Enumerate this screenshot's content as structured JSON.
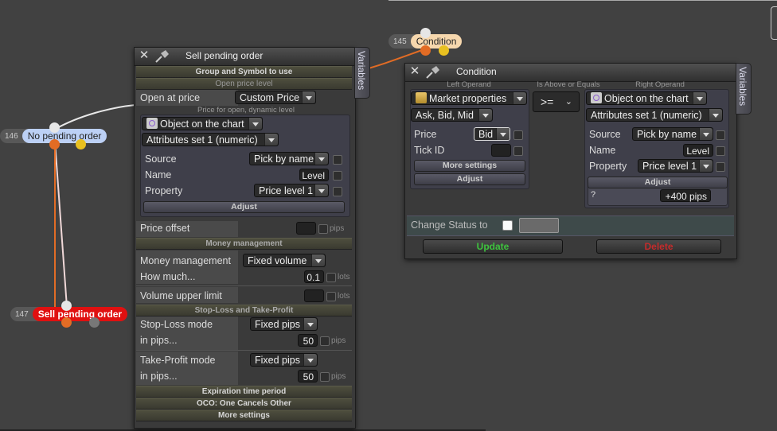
{
  "colors": {
    "accent_orange": "#e26c25",
    "node_blue": "#bcd0f5",
    "node_red": "#e01010",
    "update_green": "#3ec33e",
    "delete_red": "#c42b2b"
  },
  "nodes": [
    {
      "num": "145",
      "label": "Condition"
    },
    {
      "num": "146",
      "label": "No pending order"
    },
    {
      "num": "147",
      "label": "Sell pending order"
    }
  ],
  "sell_panel": {
    "title": "Sell pending order",
    "variables_tab": "Variables",
    "sections": {
      "group_symbol": "Group and Symbol to use",
      "open_price": "Open price level",
      "money": "Money management",
      "sltp": "Stop-Loss and Take-Profit",
      "expiration": "Expiration time period",
      "oco": "OCO: One Cancels Other",
      "more": "More settings"
    },
    "open_at_price_label": "Open at price",
    "open_at_price_value": "Custom Price",
    "price_sub_label": "Price for open, dynamic level",
    "object_value": "Object on the chart",
    "attributes_value": "Attributes set 1 (numeric)",
    "source_label": "Source",
    "source_value": "Pick by name",
    "name_label": "Name",
    "name_value": "Level",
    "property_label": "Property",
    "property_value": "Price level 1",
    "adjust_label": "Adjust",
    "price_offset_label": "Price offset",
    "pips": "pips",
    "lots": "lots",
    "money_mgmt_label": "Money management",
    "money_mgmt_value": "Fixed volume",
    "how_much_label": "How much...",
    "how_much_value": "0.1",
    "volume_upper_label": "Volume upper limit",
    "sl_mode_label": "Stop-Loss mode",
    "sl_mode_value": "Fixed pips",
    "sl_in_pips_label": "in pips...",
    "sl_in_pips_value": "50",
    "tp_mode_label": "Take-Profit mode",
    "tp_mode_value": "Fixed pips",
    "tp_in_pips_label": "in pips...",
    "tp_in_pips_value": "50"
  },
  "condition_panel": {
    "title": "Condition",
    "variables_tab": "Variables",
    "left_operand_label": "Left Operand",
    "comparison_label": "Is Above or Equals",
    "right_operand_label": "Right Operand",
    "left": {
      "source_value": "Market properties",
      "type_value": "Ask, Bid, Mid",
      "price_label": "Price",
      "price_value": "Bid",
      "tick_id_label": "Tick ID",
      "more_settings": "More settings",
      "adjust": "Adjust"
    },
    "operator_value": ">=",
    "right": {
      "source_value": "Object on the chart",
      "attributes_value": "Attributes set 1 (numeric)",
      "source_label": "Source",
      "source_pick": "Pick by name",
      "name_label": "Name",
      "name_value": "Level",
      "property_label": "Property",
      "property_value": "Price level 1",
      "adjust": "Adjust",
      "q_label": "?",
      "adjust_value": "+400 pips"
    },
    "change_status_label": "Change Status to",
    "update_label": "Update",
    "delete_label": "Delete"
  }
}
